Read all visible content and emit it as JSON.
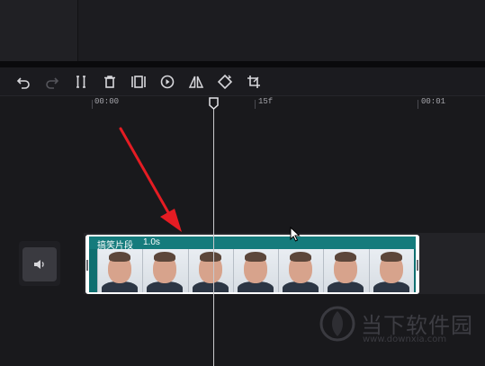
{
  "toolbar": {
    "tools": [
      {
        "icon": "undo-icon"
      },
      {
        "icon": "redo-icon",
        "disabled": true
      },
      {
        "icon": "split-icon"
      },
      {
        "icon": "delete-icon"
      },
      {
        "icon": "freeze-frame-icon"
      },
      {
        "icon": "play-reverse-icon"
      },
      {
        "icon": "mirror-icon"
      },
      {
        "icon": "rotate-icon"
      },
      {
        "icon": "crop-icon"
      }
    ]
  },
  "ruler": {
    "labels": [
      "00:00",
      "15f",
      "00:01"
    ]
  },
  "track": {
    "audio_icon": "volume-icon"
  },
  "clip": {
    "name": "搞笑片段",
    "duration": "1.0s",
    "frame_count": 7
  },
  "watermark": {
    "text": "当下软件园",
    "url": "www.downxia.com"
  },
  "colors": {
    "background": "#19191c",
    "clip_accent": "#0f6f70",
    "annotation_arrow": "#e51c23",
    "playhead": "#c8c8cc"
  }
}
